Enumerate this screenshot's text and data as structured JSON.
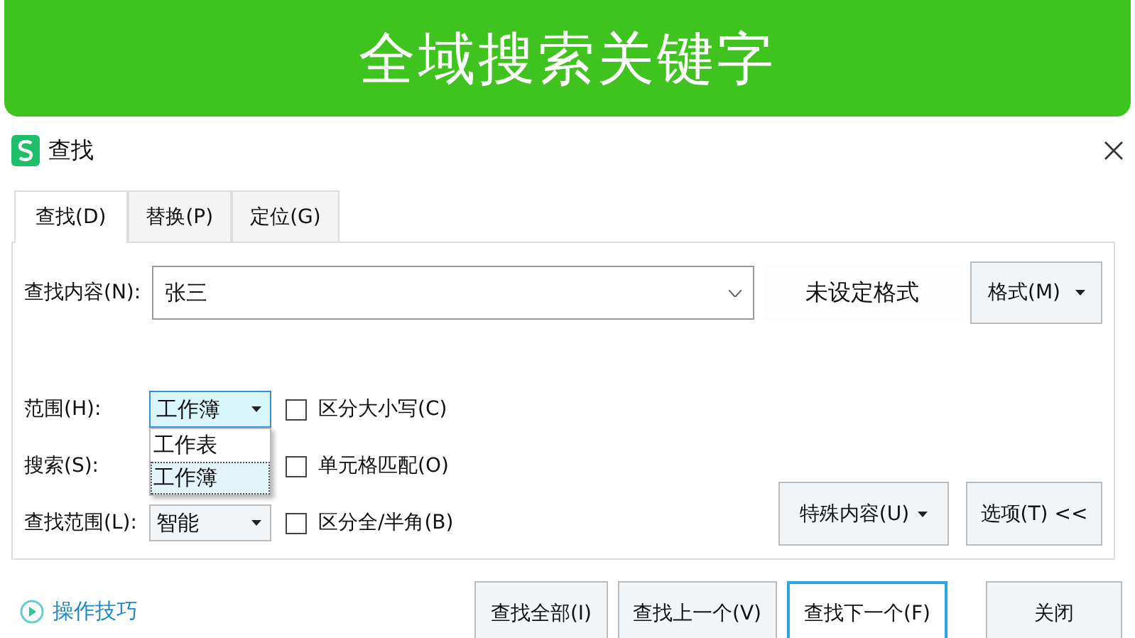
{
  "banner": {
    "title": "全域搜索关键字"
  },
  "window": {
    "title": "查找"
  },
  "tabs": [
    {
      "label": "查找(D)",
      "selected": true
    },
    {
      "label": "替换(P)",
      "selected": false
    },
    {
      "label": "定位(G)",
      "selected": false
    }
  ],
  "find": {
    "label": "查找内容(N):",
    "value": "张三",
    "format_status": "未设定格式",
    "format_button": "格式(M)"
  },
  "options": {
    "range": {
      "label": "范围(H):",
      "value": "工作簿",
      "dropdown": [
        {
          "label": "工作表",
          "selected": false
        },
        {
          "label": "工作簿",
          "selected": true
        }
      ]
    },
    "search": {
      "label": "搜索(S):"
    },
    "scope": {
      "label": "查找范围(L):",
      "value": "智能"
    },
    "checkboxes": [
      {
        "label": "区分大小写(C)",
        "checked": false
      },
      {
        "label": "单元格匹配(O)",
        "checked": false
      },
      {
        "label": "区分全/半角(B)",
        "checked": false
      }
    ],
    "special_button": "特殊内容(U)",
    "options_button": "选项(T) <<"
  },
  "footer": {
    "tips_link": "操作技巧",
    "buttons": [
      {
        "label": "查找全部(I)",
        "focused": false
      },
      {
        "label": "查找上一个(V)",
        "focused": false
      },
      {
        "label": "查找下一个(F)",
        "focused": true
      },
      {
        "label": "关闭",
        "focused": false
      }
    ]
  }
}
